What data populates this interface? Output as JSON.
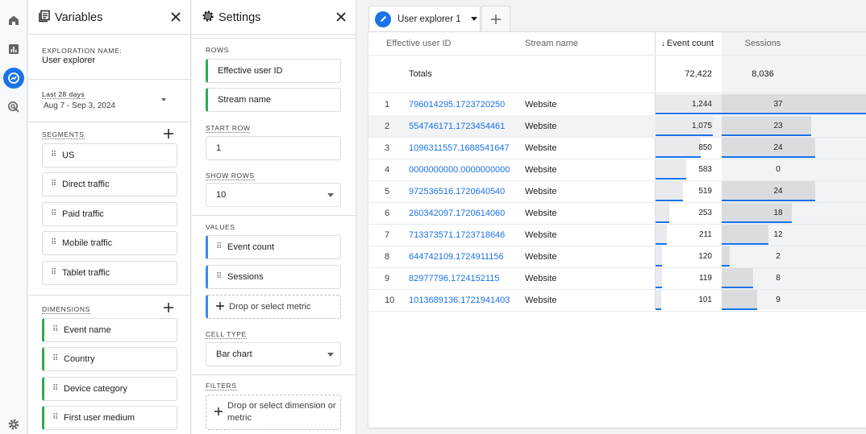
{
  "rail": {
    "icons": [
      "home-icon",
      "reports-icon",
      "explore-icon",
      "advertising-icon",
      "settings-icon"
    ],
    "active_color": "#1a73e8"
  },
  "variables": {
    "title": "Variables",
    "exploration_name_label": "EXPLORATION NAME:",
    "exploration_name": "User explorer",
    "date_label": "Last 28 days",
    "date_range": "Aug 7 - Sep 3, 2024",
    "segments_label": "SEGMENTS",
    "segments": [
      "US",
      "Direct traffic",
      "Paid traffic",
      "Mobile traffic",
      "Tablet traffic"
    ],
    "dimensions_label": "DIMENSIONS",
    "dimensions": [
      "Event name",
      "Country",
      "Device category",
      "First user medium"
    ]
  },
  "settings": {
    "title": "Settings",
    "rows_label": "ROWS",
    "rows": [
      "Effective user ID",
      "Stream name"
    ],
    "start_row_label": "START ROW",
    "start_row": "1",
    "show_rows_label": "SHOW ROWS",
    "show_rows": "10",
    "values_label": "VALUES",
    "values": [
      "Event count",
      "Sessions"
    ],
    "drop_metric": "Drop or select metric",
    "cell_type_label": "CELL TYPE",
    "cell_type": "Bar chart",
    "filters_label": "FILTERS",
    "drop_filter": "Drop or select dimension or metric"
  },
  "tab": {
    "label": "User explorer 1"
  },
  "table": {
    "headers": {
      "user_id": "Effective user ID",
      "stream": "Stream name",
      "event_count": "Event count",
      "sessions": "Sessions"
    },
    "totals_label": "Totals",
    "totals_event_count": "72,422",
    "totals_sessions": "8,036",
    "rows": [
      {
        "n": "1",
        "id": "796014295.1723720250",
        "stream": "Website",
        "events": "1,244",
        "sessions": "37",
        "ev": 1244,
        "ss": 37
      },
      {
        "n": "2",
        "id": "554746171.1723454461",
        "stream": "Website",
        "events": "1,075",
        "sessions": "23",
        "ev": 1075,
        "ss": 23
      },
      {
        "n": "3",
        "id": "1096311557.1688541647",
        "stream": "Website",
        "events": "850",
        "sessions": "24",
        "ev": 850,
        "ss": 24
      },
      {
        "n": "4",
        "id": "0000000000.0000000000",
        "stream": "Website",
        "events": "583",
        "sessions": "0",
        "ev": 583,
        "ss": 0
      },
      {
        "n": "5",
        "id": "972536516.1720640540",
        "stream": "Website",
        "events": "519",
        "sessions": "24",
        "ev": 519,
        "ss": 24
      },
      {
        "n": "6",
        "id": "260342097.1720614060",
        "stream": "Website",
        "events": "253",
        "sessions": "18",
        "ev": 253,
        "ss": 18
      },
      {
        "n": "7",
        "id": "713373571.1723718646",
        "stream": "Website",
        "events": "211",
        "sessions": "12",
        "ev": 211,
        "ss": 12
      },
      {
        "n": "8",
        "id": "644742109.1724911156",
        "stream": "Website",
        "events": "120",
        "sessions": "2",
        "ev": 120,
        "ss": 2
      },
      {
        "n": "9",
        "id": "82977796.1724152115",
        "stream": "Website",
        "events": "119",
        "sessions": "8",
        "ev": 119,
        "ss": 8
      },
      {
        "n": "10",
        "id": "1013689136.1721941403",
        "stream": "Website",
        "events": "101",
        "sessions": "9",
        "ev": 101,
        "ss": 9
      }
    ],
    "highlight_row": "2",
    "link_color": "#1a73e8",
    "bar_color": "#e8eaed",
    "bar_line_color": "#1a73e8"
  }
}
